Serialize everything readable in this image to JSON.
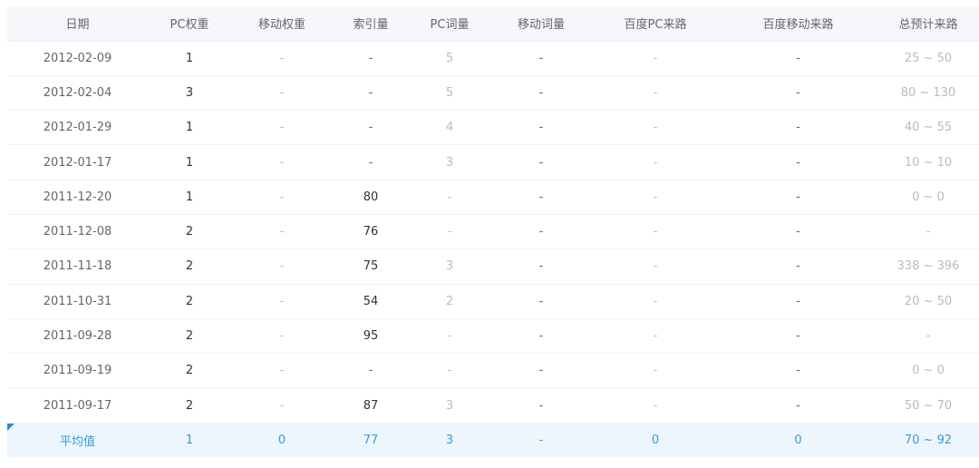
{
  "table": {
    "headers": [
      "日期",
      "PC权重",
      "移动权重",
      "索引量",
      "PC词量",
      "移动词量",
      "百度PC来路",
      "百度移动来路",
      "总预计来路"
    ],
    "rows": [
      [
        "2012-02-09",
        "1",
        "-",
        "-",
        "5",
        "-",
        "-",
        "-",
        "25 ~ 50"
      ],
      [
        "2012-02-04",
        "3",
        "-",
        "-",
        "5",
        "-",
        "-",
        "-",
        "80 ~ 130"
      ],
      [
        "2012-01-29",
        "1",
        "-",
        "-",
        "4",
        "-",
        "-",
        "-",
        "40 ~ 55"
      ],
      [
        "2012-01-17",
        "1",
        "-",
        "-",
        "3",
        "-",
        "-",
        "-",
        "10 ~ 10"
      ],
      [
        "2011-12-20",
        "1",
        "-",
        "80",
        "-",
        "-",
        "-",
        "-",
        "0 ~ 0"
      ],
      [
        "2011-12-08",
        "2",
        "-",
        "76",
        "-",
        "-",
        "-",
        "-",
        "-"
      ],
      [
        "2011-11-18",
        "2",
        "-",
        "75",
        "3",
        "-",
        "-",
        "-",
        "338 ~ 396"
      ],
      [
        "2011-10-31",
        "2",
        "-",
        "54",
        "2",
        "-",
        "-",
        "-",
        "20 ~ 50"
      ],
      [
        "2011-09-28",
        "2",
        "-",
        "95",
        "-",
        "-",
        "-",
        "-",
        "-"
      ],
      [
        "2011-09-19",
        "2",
        "-",
        "-",
        "-",
        "-",
        "-",
        "-",
        "0 ~ 0"
      ],
      [
        "2011-09-17",
        "2",
        "-",
        "87",
        "3",
        "-",
        "-",
        "-",
        "50 ~ 70"
      ]
    ],
    "footer": [
      "平均值",
      "1",
      "0",
      "77",
      "3",
      "-",
      "0",
      "0",
      "70 ~ 92"
    ]
  },
  "colors": {
    "header_bg": "#f5f7fa",
    "footer_bg": "#edf6fd",
    "footer_text": "#3a9ad9",
    "corner_mark": "#2b8ad6"
  }
}
